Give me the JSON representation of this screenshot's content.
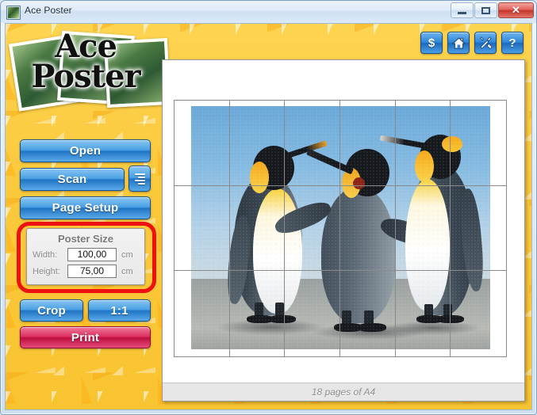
{
  "window": {
    "title": "Ace Poster",
    "app_icon": "app-photo-icon",
    "caption": {
      "minimize": "minimize-icon",
      "maximize": "maximize-icon",
      "close": "✕"
    }
  },
  "logo": {
    "line1": "Ace",
    "line2": "Poster"
  },
  "toolbar": {
    "buttons": [
      {
        "name": "buy-button",
        "glyph": "$",
        "label": "S"
      },
      {
        "name": "home-button",
        "glyph": "⌂",
        "label": "Home"
      },
      {
        "name": "tools-button",
        "glyph": "⚒",
        "label": "Tools"
      },
      {
        "name": "help-button",
        "glyph": "?",
        "label": "Help"
      }
    ]
  },
  "sidebar": {
    "open_label": "Open",
    "scan_label": "Scan",
    "scan_menu_label": "scan-options-icon",
    "page_setup_label": "Page Setup",
    "crop_label": "Crop",
    "ratio_label": "1:1",
    "print_label": "Print"
  },
  "poster_size": {
    "title": "Poster Size",
    "width_label": "Width:",
    "width_value": "100,00",
    "width_unit": "cm",
    "height_label": "Height:",
    "height_value": "75,00",
    "height_unit": "cm",
    "highlight_color": "#ee1111"
  },
  "preview": {
    "grid_columns": 6,
    "grid_rows": 3,
    "photo_alt": "three-king-penguins-on-beach",
    "status_text": "18 pages of A4"
  },
  "colors": {
    "background": "#fbc93d",
    "button_blue": "#2f86d8",
    "print_red": "#dc2f60",
    "annotation_red": "#ee1111",
    "titlebar": "#dfeaf7"
  }
}
